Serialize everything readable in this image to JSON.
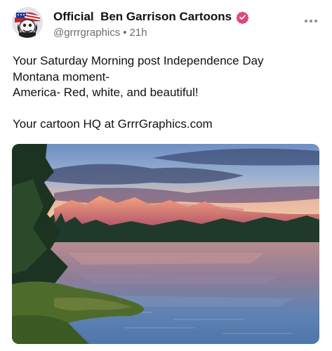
{
  "author": {
    "display_name": "Official  Ben Garrison Cartoons",
    "handle": "@grrrgraphics",
    "separator": "•",
    "time": "21h",
    "verified_color": "#e0457b"
  },
  "post": {
    "lines": [
      "Your Saturday Morning post Independence Day",
      "Montana moment-",
      "America- Red, white, and beautiful!",
      "",
      "Your cartoon HQ at GrrrGraphics.com"
    ]
  },
  "icons": {
    "more": "more-horizontal-icon",
    "verified": "verified-badge-icon"
  },
  "colors": {
    "text": "#111111",
    "meta": "#6b6b70"
  }
}
